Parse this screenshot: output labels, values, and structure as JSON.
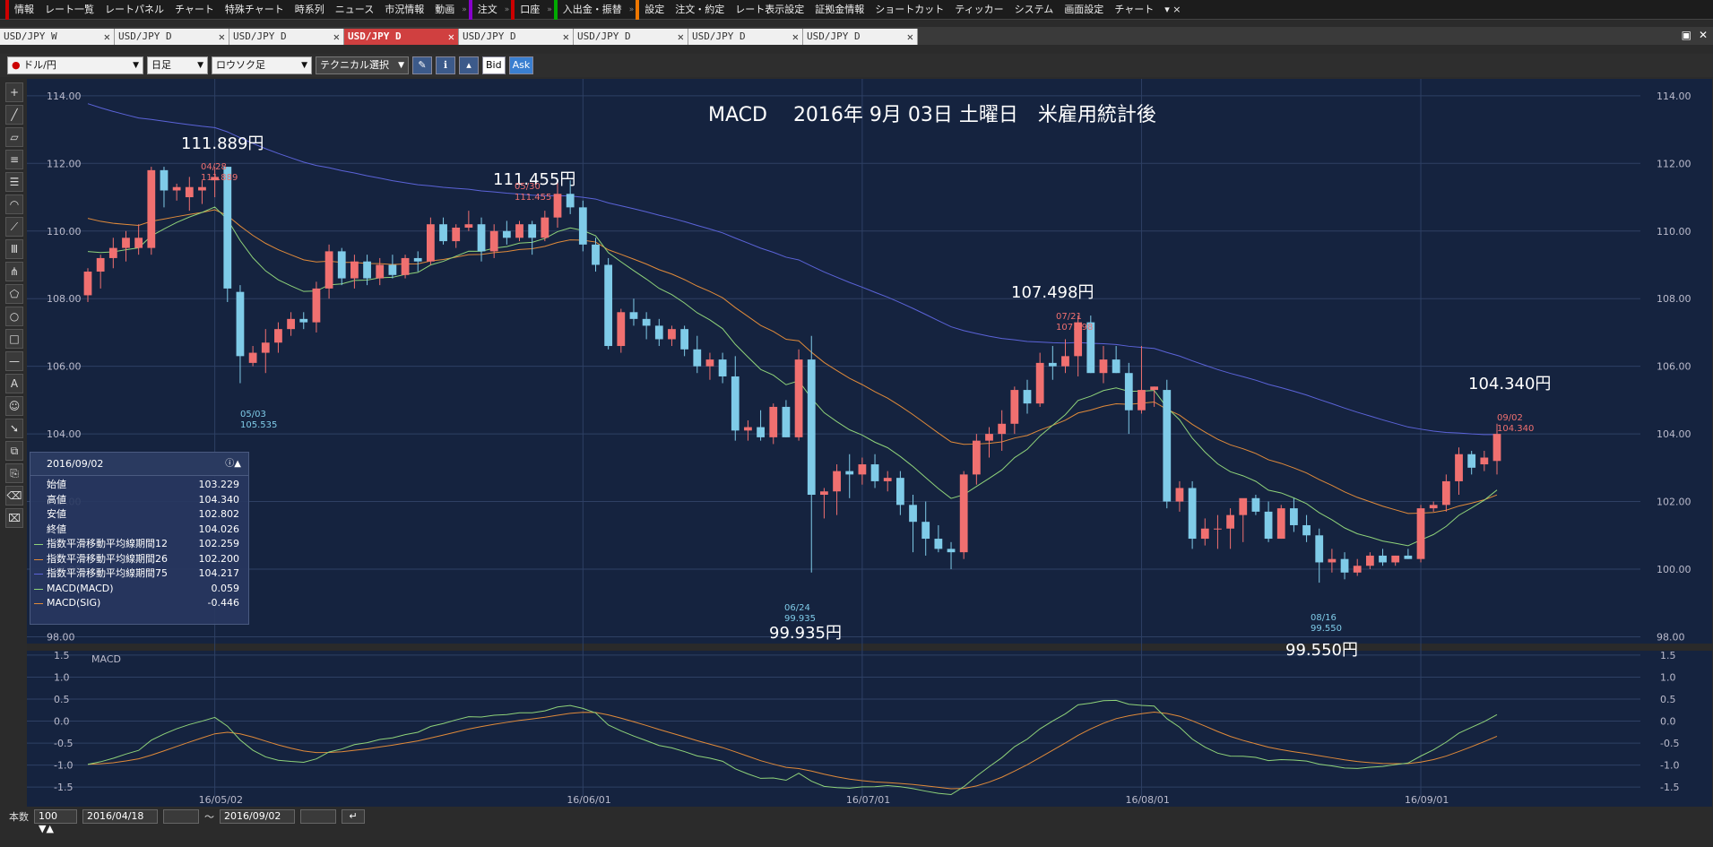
{
  "menu": [
    "情報",
    "レート一覧",
    "レートパネル",
    "チャート",
    "特殊チャート",
    "時系列",
    "ニュース",
    "市況情報",
    "動画",
    "注文",
    "口座",
    "入出金・振替",
    "設定",
    "注文・約定",
    "レート表示設定",
    "証拠金情報",
    "ショートカット",
    "ティッカー",
    "システム",
    "画面設定",
    "チャート"
  ],
  "tabs": [
    "USD/JPY W",
    "USD/JPY D",
    "USD/JPY D",
    "USD/JPY D",
    "USD/JPY D",
    "USD/JPY D",
    "USD/JPY D",
    "USD/JPY D"
  ],
  "active_tab": 3,
  "toolbar": {
    "pair": "ドル/円",
    "period": "日足",
    "style": "ロウソク足",
    "tech": "テクニカル選択",
    "bid": "Bid",
    "ask": "Ask"
  },
  "chart_title": "MACD　 2016年 9月 03日 土曜日　米雇用統計後",
  "info": {
    "date": "2016/09/02",
    "rows": [
      {
        "label": "始値",
        "value": "103.229",
        "color": ""
      },
      {
        "label": "高値",
        "value": "104.340",
        "color": ""
      },
      {
        "label": "安値",
        "value": "102.802",
        "color": ""
      },
      {
        "label": "終値",
        "value": "104.026",
        "color": ""
      },
      {
        "label": "指数平滑移動平均線期間12",
        "value": "102.259",
        "color": "#8fd37a"
      },
      {
        "label": "指数平滑移動平均線期間26",
        "value": "102.200",
        "color": "#e08a3a"
      },
      {
        "label": "指数平滑移動平均線期間75",
        "value": "104.217",
        "color": "#5b63d8"
      },
      {
        "label": "MACD(MACD)",
        "value": "0.059",
        "color": "#8fd37a"
      },
      {
        "label": "MACD(SIG)",
        "value": "-0.446",
        "color": "#e08a3a"
      }
    ]
  },
  "bottom": {
    "count_label": "本数",
    "count": "100",
    "from": "2016/04/18",
    "to": "2016/09/02",
    "tilde": "〜"
  },
  "colors": {
    "up": "#f07070",
    "down": "#7fcbe8",
    "bg": "#15233f",
    "ema12": "#8fd37a",
    "ema26": "#e08a3a",
    "ema75": "#5b63d8"
  },
  "chart_data": {
    "type": "line",
    "price_axis": {
      "ticks": [
        "114.00",
        "112.00",
        "110.00",
        "108.00",
        "106.00",
        "104.00",
        "102.00",
        "100.00",
        "98.00"
      ],
      "ylim": [
        97.8,
        114.5
      ]
    },
    "macd_axis": {
      "label": "MACD",
      "ticks": [
        "1.5",
        "1.0",
        "0.5",
        "0.0",
        "-0.5",
        "-1.0",
        "-1.5"
      ],
      "ylim": [
        -1.7,
        1.6
      ]
    },
    "x_ticks": [
      "16/05/02",
      "16/06/01",
      "16/07/01",
      "16/08/01",
      "16/09/01"
    ],
    "annotations": [
      {
        "big": "111.889円",
        "date": "04/28",
        "val": "111.889",
        "color": "#f07070"
      },
      {
        "big": "111.455円",
        "date": "05/30",
        "val": "111.455",
        "color": "#f07070"
      },
      {
        "big": "",
        "date": "05/03",
        "val": "105.535",
        "color": "#7fcbe8"
      },
      {
        "big": "99.935円",
        "date": "06/24",
        "val": "99.935",
        "color": "#7fcbe8"
      },
      {
        "big": "107.498円",
        "date": "07/21",
        "val": "107.498",
        "color": "#f07070"
      },
      {
        "big": "99.550円",
        "date": "08/16",
        "val": "99.550",
        "color": "#7fcbe8"
      },
      {
        "big": "104.340円",
        "date": "09/02",
        "val": "104.340",
        "color": "#f07070"
      }
    ],
    "candles": [
      [
        108.1,
        108.9,
        107.9,
        108.8
      ],
      [
        108.8,
        109.3,
        108.3,
        109.2
      ],
      [
        109.2,
        109.8,
        108.9,
        109.5
      ],
      [
        109.5,
        110.0,
        109.1,
        109.8
      ],
      [
        109.5,
        110.2,
        109.3,
        109.8
      ],
      [
        109.5,
        111.9,
        109.3,
        111.8
      ],
      [
        111.8,
        111.9,
        110.7,
        111.2
      ],
      [
        111.2,
        111.4,
        110.9,
        111.3
      ],
      [
        111.0,
        111.6,
        110.6,
        111.3
      ],
      [
        111.2,
        111.5,
        110.8,
        111.3
      ],
      [
        111.5,
        111.9,
        111.0,
        111.6
      ],
      [
        111.9,
        111.9,
        107.9,
        108.3
      ],
      [
        108.2,
        108.4,
        105.5,
        106.3
      ],
      [
        106.1,
        106.6,
        106.0,
        106.4
      ],
      [
        106.4,
        107.1,
        105.8,
        106.7
      ],
      [
        106.7,
        107.3,
        106.4,
        107.1
      ],
      [
        107.1,
        107.6,
        106.9,
        107.4
      ],
      [
        107.4,
        107.6,
        107.1,
        107.3
      ],
      [
        107.3,
        108.5,
        107.0,
        108.3
      ],
      [
        108.3,
        109.6,
        108.0,
        109.4
      ],
      [
        109.4,
        109.5,
        108.4,
        108.6
      ],
      [
        108.6,
        109.3,
        108.3,
        109.1
      ],
      [
        109.1,
        109.3,
        108.4,
        108.6
      ],
      [
        108.6,
        109.2,
        108.4,
        109.0
      ],
      [
        109.0,
        109.3,
        108.6,
        108.7
      ],
      [
        108.7,
        109.3,
        108.6,
        109.2
      ],
      [
        109.2,
        109.4,
        108.8,
        109.1
      ],
      [
        109.1,
        110.4,
        109.0,
        110.2
      ],
      [
        110.2,
        110.4,
        109.6,
        109.7
      ],
      [
        109.7,
        110.2,
        109.5,
        110.1
      ],
      [
        110.1,
        110.6,
        110.0,
        110.2
      ],
      [
        110.2,
        110.4,
        109.1,
        109.4
      ],
      [
        109.4,
        110.2,
        109.2,
        110.0
      ],
      [
        110.0,
        110.3,
        109.6,
        109.8
      ],
      [
        109.8,
        110.3,
        109.7,
        110.2
      ],
      [
        110.2,
        110.3,
        109.3,
        109.8
      ],
      [
        109.8,
        110.6,
        109.7,
        110.4
      ],
      [
        110.4,
        111.5,
        110.1,
        111.1
      ],
      [
        111.1,
        111.5,
        110.5,
        110.7
      ],
      [
        110.7,
        110.9,
        109.4,
        109.6
      ],
      [
        109.6,
        109.8,
        108.8,
        109.0
      ],
      [
        109.0,
        109.2,
        106.5,
        106.6
      ],
      [
        106.6,
        107.7,
        106.4,
        107.6
      ],
      [
        107.6,
        108.0,
        107.2,
        107.4
      ],
      [
        107.4,
        107.6,
        106.8,
        107.2
      ],
      [
        107.2,
        107.4,
        106.6,
        106.8
      ],
      [
        106.8,
        107.2,
        106.6,
        107.1
      ],
      [
        107.1,
        107.2,
        106.3,
        106.5
      ],
      [
        106.5,
        106.9,
        105.8,
        106.0
      ],
      [
        106.0,
        106.4,
        105.6,
        106.2
      ],
      [
        106.2,
        106.4,
        105.5,
        105.7
      ],
      [
        105.7,
        106.3,
        103.8,
        104.1
      ],
      [
        104.1,
        104.4,
        103.8,
        104.2
      ],
      [
        104.2,
        104.7,
        103.8,
        103.9
      ],
      [
        103.9,
        104.9,
        103.7,
        104.8
      ],
      [
        104.8,
        105.0,
        103.9,
        103.9
      ],
      [
        103.9,
        106.5,
        103.8,
        106.2
      ],
      [
        106.2,
        106.9,
        99.9,
        102.2
      ],
      [
        102.2,
        102.4,
        101.5,
        102.3
      ],
      [
        102.3,
        103.1,
        101.6,
        102.9
      ],
      [
        102.9,
        103.4,
        102.1,
        102.8
      ],
      [
        102.8,
        103.3,
        102.5,
        103.1
      ],
      [
        103.1,
        103.4,
        102.4,
        102.6
      ],
      [
        102.6,
        102.9,
        102.3,
        102.7
      ],
      [
        102.7,
        102.9,
        101.6,
        101.9
      ],
      [
        101.9,
        102.2,
        100.5,
        101.4
      ],
      [
        101.4,
        102.0,
        100.4,
        100.9
      ],
      [
        100.9,
        101.3,
        100.5,
        100.6
      ],
      [
        100.6,
        100.8,
        100.0,
        100.5
      ],
      [
        100.5,
        102.9,
        100.3,
        102.8
      ],
      [
        102.8,
        104.0,
        102.5,
        103.8
      ],
      [
        103.8,
        104.2,
        103.3,
        104.0
      ],
      [
        104.0,
        104.7,
        103.5,
        104.3
      ],
      [
        104.3,
        105.4,
        104.0,
        105.3
      ],
      [
        105.3,
        105.6,
        104.6,
        104.9
      ],
      [
        104.9,
        106.4,
        104.8,
        106.1
      ],
      [
        106.1,
        106.6,
        105.6,
        106.0
      ],
      [
        106.0,
        106.8,
        105.8,
        106.3
      ],
      [
        106.3,
        107.5,
        105.7,
        107.3
      ],
      [
        107.3,
        107.5,
        105.8,
        105.8
      ],
      [
        105.8,
        106.6,
        105.5,
        106.2
      ],
      [
        106.2,
        106.6,
        105.8,
        105.8
      ],
      [
        105.8,
        106.1,
        104.0,
        104.7
      ],
      [
        104.7,
        106.6,
        104.6,
        105.3
      ],
      [
        105.3,
        105.4,
        104.8,
        105.4
      ],
      [
        105.3,
        105.6,
        101.8,
        102.0
      ],
      [
        102.0,
        102.6,
        101.7,
        102.4
      ],
      [
        102.4,
        102.6,
        100.6,
        100.9
      ],
      [
        100.9,
        101.5,
        100.7,
        101.2
      ],
      [
        101.2,
        101.6,
        100.6,
        101.2
      ],
      [
        101.2,
        101.8,
        100.6,
        101.6
      ],
      [
        101.6,
        102.0,
        100.8,
        102.1
      ],
      [
        102.1,
        102.2,
        101.6,
        101.7
      ],
      [
        101.7,
        102.0,
        100.8,
        100.9
      ],
      [
        100.9,
        101.9,
        100.9,
        101.8
      ],
      [
        101.8,
        102.1,
        101.1,
        101.3
      ],
      [
        101.3,
        101.6,
        100.8,
        101.0
      ],
      [
        101.0,
        101.2,
        99.6,
        100.2
      ],
      [
        100.2,
        100.6,
        99.9,
        100.3
      ],
      [
        100.3,
        100.5,
        99.7,
        99.9
      ],
      [
        99.9,
        100.3,
        99.8,
        100.1
      ],
      [
        100.1,
        100.5,
        100.0,
        100.4
      ],
      [
        100.4,
        100.6,
        100.1,
        100.2
      ],
      [
        100.2,
        100.4,
        100.1,
        100.4
      ],
      [
        100.4,
        100.6,
        100.3,
        100.3
      ],
      [
        100.3,
        101.9,
        100.2,
        101.8
      ],
      [
        101.8,
        102.0,
        101.7,
        101.9
      ],
      [
        101.9,
        102.8,
        101.7,
        102.6
      ],
      [
        102.6,
        103.6,
        102.2,
        103.4
      ],
      [
        103.4,
        103.5,
        102.8,
        103.0
      ],
      [
        103.1,
        103.5,
        102.9,
        103.3
      ],
      [
        103.2,
        104.3,
        102.8,
        104.0
      ]
    ]
  }
}
